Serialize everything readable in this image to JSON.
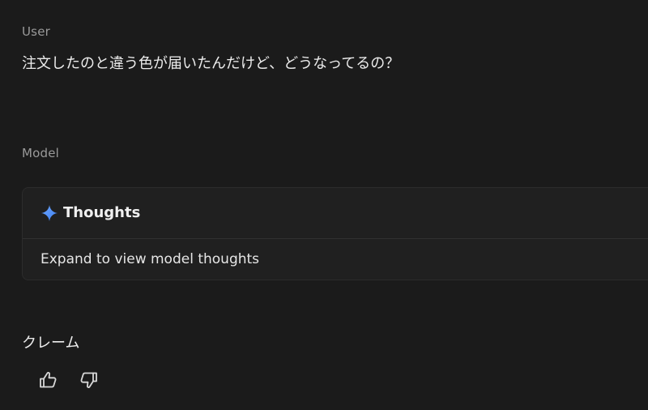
{
  "conversation": {
    "user": {
      "role_label": "User",
      "message": "注文したのと違う色が届いたんだけど、どうなってるの？"
    },
    "model": {
      "role_label": "Model",
      "thoughts": {
        "icon": "sparkle-icon",
        "title": "Thoughts",
        "body": "Expand to view model thoughts"
      },
      "response": "クレーム"
    }
  },
  "feedback": {
    "thumbs_up_icon": "thumbs-up-icon",
    "thumbs_down_icon": "thumbs-down-icon"
  },
  "colors": {
    "background": "#1b1b1b",
    "card_background": "#202020",
    "label_gray": "#9a9a9a",
    "spark_blue": "#4f8ff7"
  }
}
